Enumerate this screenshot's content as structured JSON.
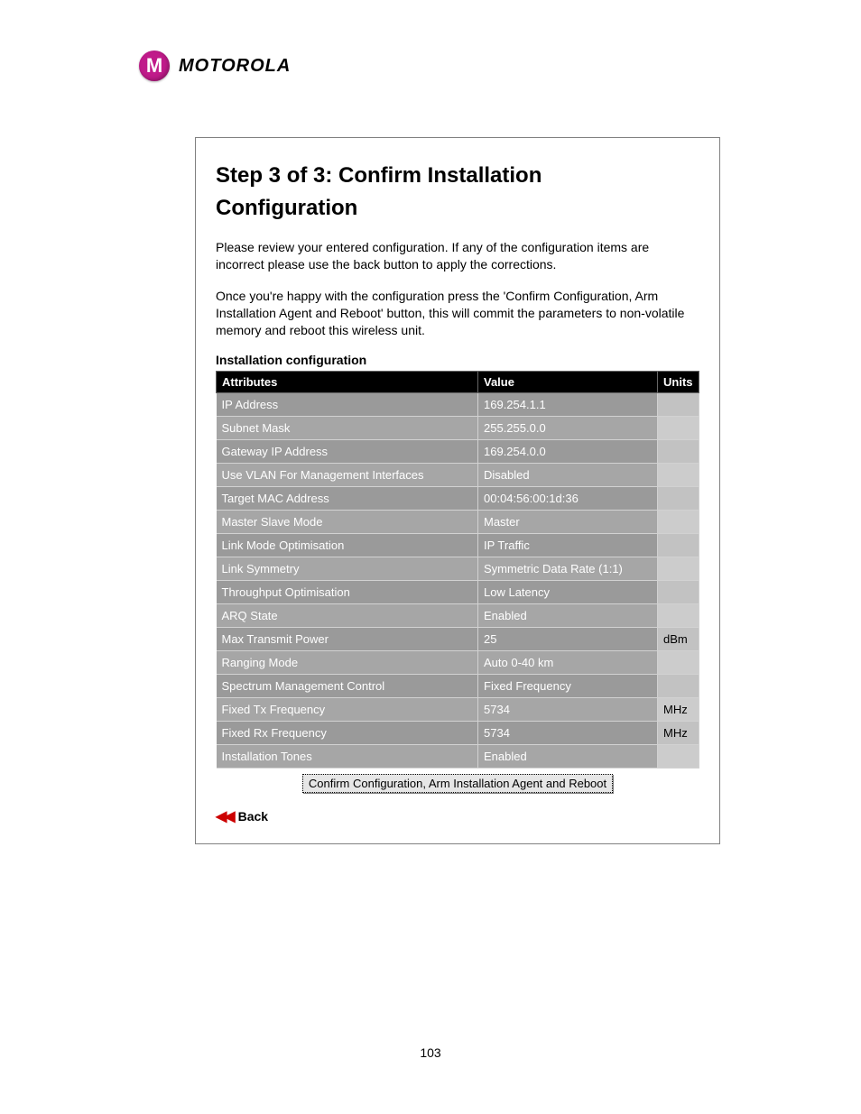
{
  "brand": "MOTOROLA",
  "page_number": "103",
  "panel": {
    "title_line1": "Step 3 of 3: Confirm Installation",
    "title_line2": "Configuration",
    "desc1": "Please review your entered configuration. If any of the configuration items are incorrect please use the back button to apply the corrections.",
    "desc2": "Once you're happy with the configuration press the 'Confirm Configuration, Arm Installation Agent and Reboot' button, this will commit the parameters to non-volatile memory and reboot this wireless unit.",
    "section_label": "Installation configuration",
    "headers": {
      "attributes": "Attributes",
      "value": "Value",
      "units": "Units"
    },
    "rows": [
      {
        "attr": "IP Address",
        "value": "169.254.1.1",
        "units": ""
      },
      {
        "attr": "Subnet Mask",
        "value": "255.255.0.0",
        "units": ""
      },
      {
        "attr": "Gateway IP Address",
        "value": "169.254.0.0",
        "units": ""
      },
      {
        "attr": "Use VLAN For Management Interfaces",
        "value": "Disabled",
        "units": ""
      },
      {
        "attr": "Target MAC Address",
        "value": "00:04:56:00:1d:36",
        "units": ""
      },
      {
        "attr": "Master Slave Mode",
        "value": "Master",
        "units": ""
      },
      {
        "attr": "Link Mode Optimisation",
        "value": "IP Traffic",
        "units": ""
      },
      {
        "attr": "Link Symmetry",
        "value": "Symmetric Data Rate (1:1)",
        "units": ""
      },
      {
        "attr": "Throughput Optimisation",
        "value": "Low Latency",
        "units": ""
      },
      {
        "attr": "ARQ State",
        "value": "Enabled",
        "units": ""
      },
      {
        "attr": "Max Transmit Power",
        "value": "25",
        "units": "dBm"
      },
      {
        "attr": "Ranging Mode",
        "value": "Auto 0-40 km",
        "units": ""
      },
      {
        "attr": "Spectrum Management Control",
        "value": "Fixed Frequency",
        "units": ""
      },
      {
        "attr": "Fixed Tx Frequency",
        "value": "5734",
        "units": "MHz"
      },
      {
        "attr": "Fixed Rx Frequency",
        "value": "5734",
        "units": "MHz"
      },
      {
        "attr": "Installation Tones",
        "value": "Enabled",
        "units": ""
      }
    ],
    "confirm_label": "Confirm Configuration, Arm Installation Agent and Reboot",
    "back_label": "Back"
  }
}
